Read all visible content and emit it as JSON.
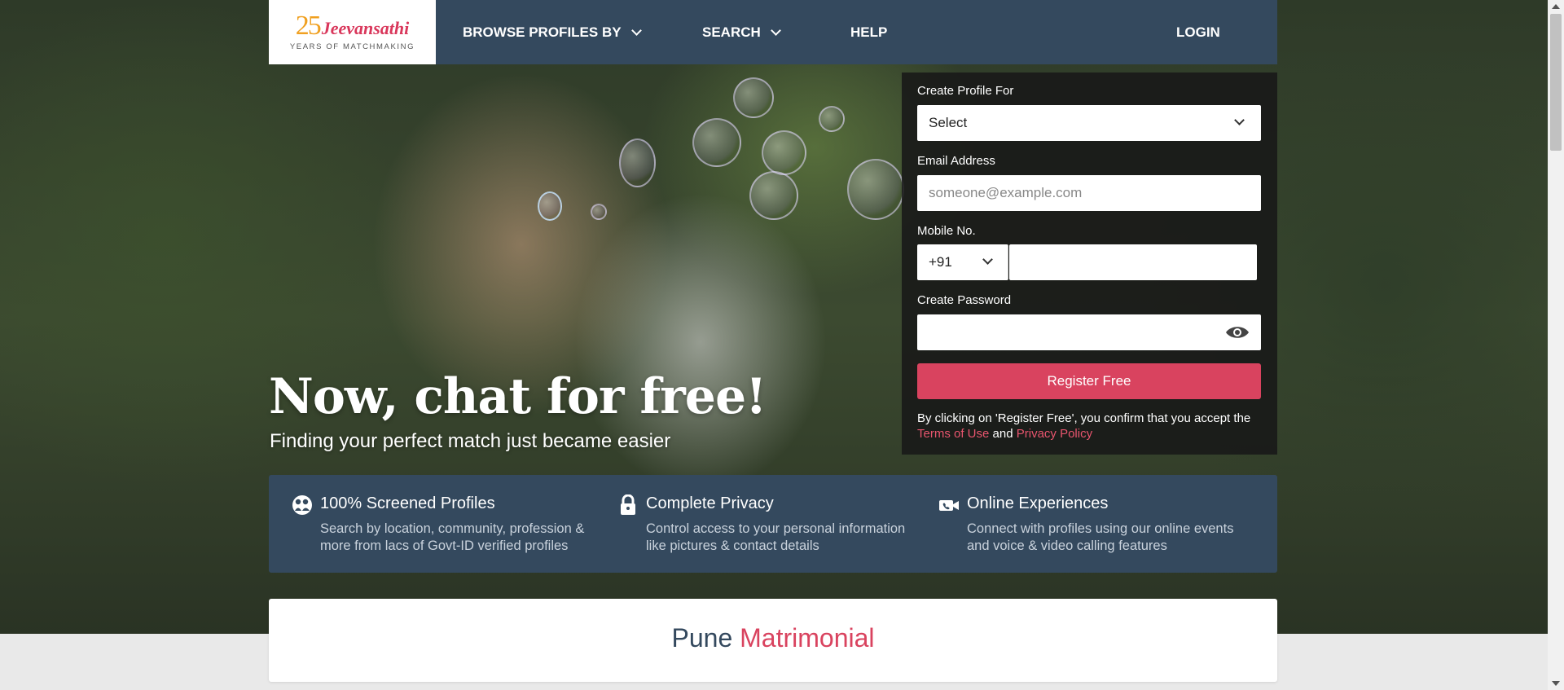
{
  "logo": {
    "number": "25",
    "name": "Jeevansathi",
    "tagline": "YEARS OF MATCHMAKING"
  },
  "nav": {
    "browse_label": "BROWSE PROFILES BY",
    "search_label": "SEARCH",
    "help_label": "HELP",
    "login_label": "LOGIN"
  },
  "hero": {
    "title": "Now, chat for free!",
    "subtitle": "Finding your perfect match just became easier"
  },
  "form": {
    "profile_for_label": "Create Profile For",
    "profile_for_value": "Select",
    "email_label": "Email Address",
    "email_placeholder": "someone@example.com",
    "mobile_label": "Mobile No.",
    "country_code": "+91",
    "mobile_value": "",
    "password_label": "Create Password",
    "password_value": "",
    "register_button": "Register Free",
    "terms_text": "By clicking on 'Register Free', you confirm that you accept the",
    "terms_link": "Terms of Use",
    "terms_and": "and",
    "privacy_link": "Privacy Policy"
  },
  "features": [
    {
      "icon": "faces-icon",
      "title": "100% Screened Profiles",
      "line1": "Search by location, community, profession &",
      "line2": "more from lacs of Govt-ID verified profiles"
    },
    {
      "icon": "lock-icon",
      "title": "Complete Privacy",
      "line1": "Control access to your personal information",
      "line2": "like pictures & contact details"
    },
    {
      "icon": "video-call-icon",
      "title": "Online Experiences",
      "line1": "Connect with profiles using our online events",
      "line2": "and voice & video calling features"
    }
  ],
  "section": {
    "title_part1": "Pune",
    "title_part2": "Matrimonial"
  },
  "colors": {
    "nav_bg": "#34495e",
    "accent": "#d9435f",
    "logo_orange": "#f0a020"
  }
}
